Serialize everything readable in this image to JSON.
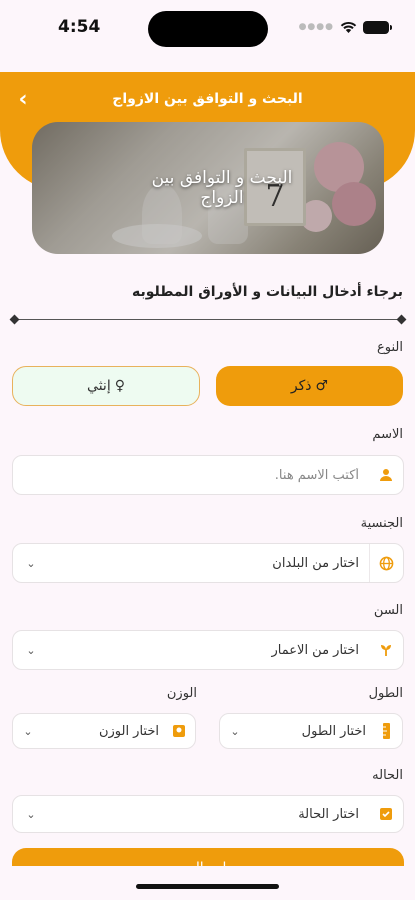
{
  "status_bar": {
    "time": "4:54"
  },
  "header": {
    "title": "البحث و التوافق بين الازواج"
  },
  "banner": {
    "text": "البحث و التوافق بين الزواج",
    "table_number": "7"
  },
  "instructions": "برجاء أدخال البيانات و الأوراق المطلوبه",
  "gender": {
    "label": "النوع",
    "male": {
      "symbol": "♂",
      "label": "ذكر"
    },
    "female": {
      "symbol": "♀",
      "label": "إنثي"
    }
  },
  "name": {
    "label": "الاسم",
    "placeholder": "أكتب الاسم هنا."
  },
  "nationality": {
    "label": "الجنسية",
    "value": "اختار من البلدان"
  },
  "age": {
    "label": "السن",
    "value": "اختار من الاعمار"
  },
  "height": {
    "label": "الطول",
    "value": "اختار الطول"
  },
  "weight": {
    "label": "الوزن",
    "value": "اختار الوزن"
  },
  "status": {
    "label": "الحاله",
    "value": "اختار الحالة"
  },
  "submit": {
    "label": "ارسال"
  },
  "colors": {
    "accent": "#ef9c0c",
    "female_bg": "#eefbf1",
    "page_bg": "#fdf6fb"
  }
}
